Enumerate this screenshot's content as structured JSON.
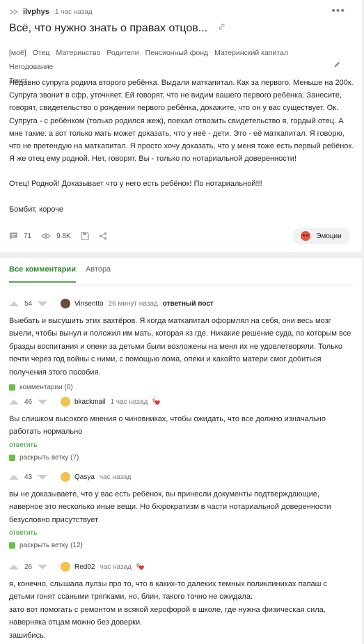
{
  "post": {
    "author": "ilvphys",
    "time": "1 час назад",
    "title": "Всё, что нужно знать о правах отцов...",
    "tags": [
      "[моё]",
      "Отец",
      "Материнство",
      "Родители",
      "Пенсионный фонд",
      "Материнский капитал",
      "Негодование",
      "Текст"
    ],
    "paragraphs": [
      "Недавно супруга родила второго ребёнка. Выдали маткапитал. Как за первого. Меньше на 200к. Супруга звонит в сфр, уточняет. Ей говорят, что не видим вашего первого ребёнка. Занесите, говорят, свидетельство о рождении первого ребёнка, докажите, что он у вас существует. Ок. Супруга - с ребёнком (только родился жеж), поехал отвозить свидетельство я, гордый отец. А мне такие: а вот только мать может доказать, что у неё - дети. Это - её маткапитал. Я говорю, что не претендую на маткапитал. Я просто хочу доказать, что у меня тоже есть первый ребёнок. Я же отец ему родной. Нет, говорят. Вы - только по нотариальной доверенности!",
      "Отец! Родной! Доказывает что у него есть ребёнок! По нотариальной!!!",
      "Бомбит, короче"
    ],
    "comments_count": "71",
    "views": "9.8K",
    "emotions_label": "Эмоции"
  },
  "tabs": [
    "Все комментарии",
    "Автора"
  ],
  "comments": [
    {
      "rating": "54",
      "user": "Vinsentto",
      "time": "26 минут назад",
      "label": "ответный пост",
      "text": "Выебать и высушить этих вахтёров. Я когда маткапитал оформлял на себя, они весь мозг выели, чтобы вынул и положил им мать, которая хз где. Никакие решение суда, по которым все бразды воспитания и опеки за детьми были возложены на меня их не удовлетворяли. Только почти через год войны с ними, с помощью лома, опеки и какойто матери смог добиться получения этого пособия.",
      "thread": "комментарии (0)"
    },
    {
      "rating": "46",
      "user": "bkackmail",
      "time": "1 час назад",
      "text": "Вы слишком высокого мнения о чиновниках, чтобы ожидать, что все должно изначально работать нормально",
      "reply": "ответить",
      "thread": "раскрыть ветку (7)"
    },
    {
      "rating": "43",
      "user": "Qasya",
      "time": "час назад",
      "text": "вы не доказываете, что у вас есть ребёнок, вы принесли документы подтверждающие, наверное это несколько иные вещи. Но бюрократизм в части нотариальной доверенности безусловно присутствует",
      "reply": "ответить",
      "thread": "раскрыть ветку (12)"
    },
    {
      "rating": "26",
      "user": "Red02",
      "time": "час назад",
      "text": "я, конечно, слышала лулзы про то, что в каких-то далеких темных поликлиниках папаш с детьми гонят ссаными тряпками, но, блин, такого точно не ожидала.\nзато вот помогать с ремонтом и всякой херофорой в школе, где нужна физическая сила, наверняка отцам можно без доверки.\nзашибись."
    }
  ]
}
